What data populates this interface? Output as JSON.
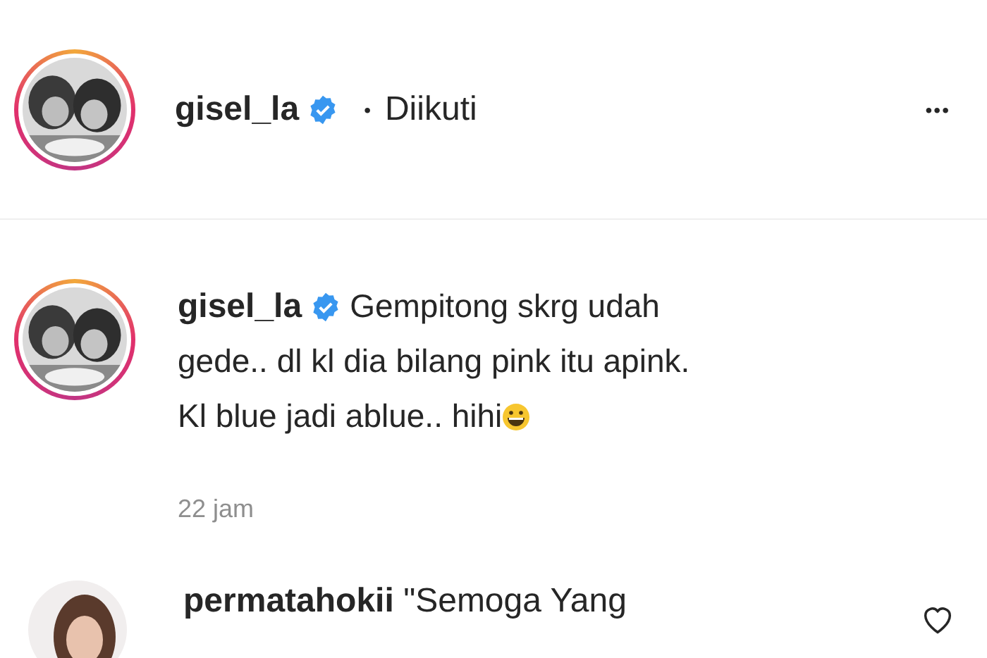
{
  "header": {
    "username": "gisel_la",
    "verified": true,
    "separator": "•",
    "follow_status": "Diikuti",
    "more": "•••"
  },
  "caption": {
    "username": "gisel_la",
    "verified": true,
    "lines": [
      "Gempitong skrg udah",
      "gede.. dl kl dia bilang pink itu apink.",
      "Kl blue jadi ablue.. hihi"
    ],
    "time": "22 jam"
  },
  "comments": [
    {
      "username": "permatahokii",
      "text": "\"Semoga Yang"
    }
  ]
}
